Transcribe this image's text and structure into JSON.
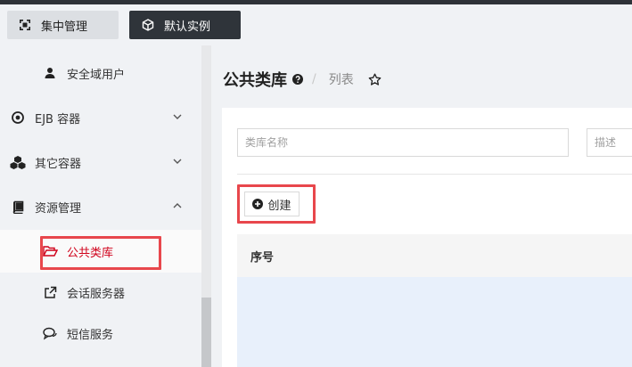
{
  "toolbar": {
    "central_label": "集中管理",
    "instance_label": "默认实例"
  },
  "sidebar": {
    "items": [
      {
        "label": "安全域用户",
        "icon": "user-icon"
      },
      {
        "label": "EJB 容器",
        "icon": "target-icon"
      },
      {
        "label": "其它容器",
        "icon": "cubes-icon"
      },
      {
        "label": "资源管理",
        "icon": "book-icon"
      },
      {
        "label": "公共类库",
        "icon": "folder-open-icon",
        "active": true
      },
      {
        "label": "会话服务器",
        "icon": "external-link-icon"
      },
      {
        "label": "短信服务",
        "icon": "comments-icon"
      }
    ]
  },
  "page": {
    "title": "公共类库",
    "breadcrumb": "列表"
  },
  "filters": {
    "name_placeholder": "类库名称",
    "desc_placeholder": "描述"
  },
  "actions": {
    "create_label": "创建"
  },
  "table": {
    "col_no": "序号"
  },
  "colors": {
    "active": "#d0021b",
    "highlight": "#e8474c",
    "dark_button": "#2f343a"
  }
}
